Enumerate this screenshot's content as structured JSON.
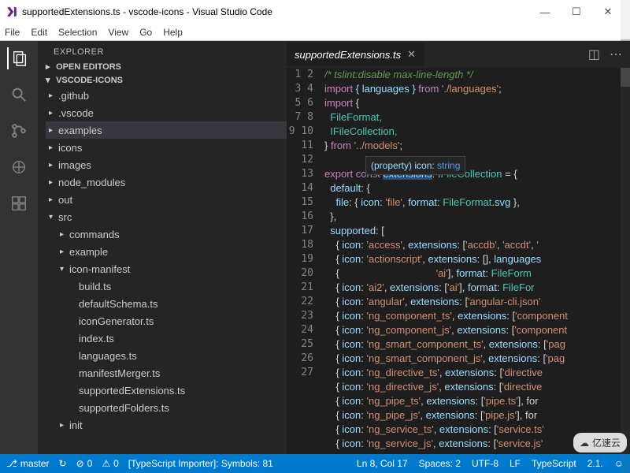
{
  "title": "supportedExtensions.ts - vscode-icons - Visual Studio Code",
  "menu": {
    "file": "File",
    "edit": "Edit",
    "selection": "Selection",
    "view": "View",
    "go": "Go",
    "help": "Help"
  },
  "sidebar": {
    "title": "EXPLORER",
    "sections": {
      "open_editors": "OPEN EDITORS",
      "project": "VSCODE-ICONS"
    },
    "tree": {
      "github": ".github",
      "vscode": ".vscode",
      "examples": "examples",
      "icons": "icons",
      "images": "images",
      "node_modules": "node_modules",
      "out": "out",
      "src": "src",
      "src_children": {
        "commands": "commands",
        "example": "example",
        "icon_manifest": "icon-manifest",
        "files": {
          "build": "build.ts",
          "defaultSchema": "defaultSchema.ts",
          "iconGenerator": "iconGenerator.ts",
          "index": "index.ts",
          "languages": "languages.ts",
          "manifestMerger": "manifestMerger.ts",
          "supportedExtensions": "supportedExtensions.ts",
          "supportedFolders": "supportedFolders.ts"
        },
        "init": "init"
      }
    }
  },
  "editor": {
    "tab": "supportedExtensions.ts",
    "line_start": 1,
    "hover": {
      "prefix": "(property)",
      "name": "icon",
      "type": "string"
    },
    "code": {
      "l1": "/* tslint:disable max-line-length */",
      "l2a": "import",
      "l2b": "{ languages }",
      "l2c": "from",
      "l2d": "'./languages'",
      "l3": "import",
      "l3b": "{",
      "l4": "FileFormat,",
      "l5": "IFileCollection,",
      "l6a": "}",
      "l6b": "from",
      "l6c": "'../models'",
      "l8a": "export const",
      "l8b": "extensions",
      "l8c": ": IFileCollection = {",
      "l9": "default: {",
      "l10a": "file: { icon:",
      "l10b": "'file'",
      "l10c": ", format: FileFormat.svg },",
      "l11": "},",
      "l12": "supported: [",
      "l13": "{ icon: 'access', extensions: ['accdb', 'accdt', '",
      "l14": "{ icon: 'actionscript', extensions: [], languages",
      "l15": "{                                  'ai'], format: FileForm",
      "l16": "{ icon: 'ai2', extensions: ['ai'], format: FileFor",
      "l17": "{ icon: 'angular', extensions: ['angular-cli.json'",
      "l18": "{ icon: 'ng_component_ts', extensions: ['component",
      "l19": "{ icon: 'ng_component_js', extensions: ['component",
      "l20": "{ icon: 'ng_smart_component_ts', extensions: ['pag",
      "l21": "{ icon: 'ng_smart_component_js', extensions: ['pag",
      "l22": "{ icon: 'ng_directive_ts', extensions: ['directive",
      "l23": "{ icon: 'ng_directive_js', extensions: ['directive",
      "l24": "{ icon: 'ng_pipe_ts', extensions: ['pipe.ts'], for",
      "l25": "{ icon: 'ng_pipe_js', extensions: ['pipe.js'], for",
      "l26": "{ icon: 'ng_service_ts', extensions: ['service.ts'",
      "l27": "{ icon: 'ng_service_js', extensions: ['service.js'"
    }
  },
  "status": {
    "branch": "master",
    "sync": "↻",
    "errors": "0",
    "warnings": "0",
    "importer": "[TypeScript Importer]: Symbols: 81",
    "cursor": "Ln 8, Col 17",
    "spaces": "Spaces: 2",
    "encoding": "UTF-8",
    "eol": "LF",
    "lang": "TypeScript",
    "tsver": "2.1.",
    "smile": "☺"
  },
  "watermark": "亿速云"
}
